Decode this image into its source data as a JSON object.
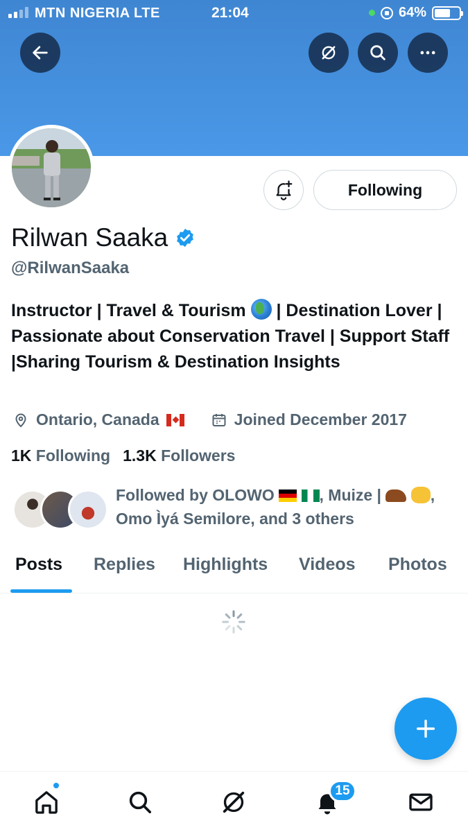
{
  "status_bar": {
    "carrier": "MTN NIGERIA  LTE",
    "time": "21:04",
    "battery": "64%",
    "battery_level": 0.64,
    "signal_bars_filled": 2,
    "signal_bars_total": 4
  },
  "header": {
    "back_icon": "arrow-left-icon",
    "grok_icon": "grok-icon",
    "search_icon": "search-icon",
    "more_icon": "more-dots-icon",
    "banner_color": "#4a98e8"
  },
  "profile": {
    "display_name": "Rilwan Saaka",
    "handle": "@RilwanSaaka",
    "verified": true,
    "bio_part1": "Instructor | Travel & Tourism",
    "bio_part2": "| Destination Lover | Passionate about Conservation Travel | Support Staff |Sharing Tourism & Destination Insights",
    "location": "Ontario, Canada",
    "joined": "Joined December 2017",
    "following_count": "1K",
    "following_label": "Following",
    "followers_count": "1.3K",
    "followers_label": "Followers",
    "followed_by_line1_prefix": "Followed by OLOWO",
    "followed_by_line1_mid": ", Muize |",
    "followed_by_line1_end": ",",
    "followed_by_line2": "Omo Ìyá Semilore, and 3 others"
  },
  "actions": {
    "following_button": "Following",
    "notify_icon": "bell-plus-icon"
  },
  "tabs": [
    "Posts",
    "Replies",
    "Highlights",
    "Videos",
    "Photos"
  ],
  "active_tab": "Posts",
  "bottom_nav": {
    "items": [
      "home-icon",
      "search-icon",
      "grok-icon",
      "bell-icon",
      "mail-icon"
    ],
    "notification_badge": "15"
  },
  "colors": {
    "accent": "#1d9bf0",
    "secondary_text": "#536471",
    "primary_text": "#0f1419"
  }
}
